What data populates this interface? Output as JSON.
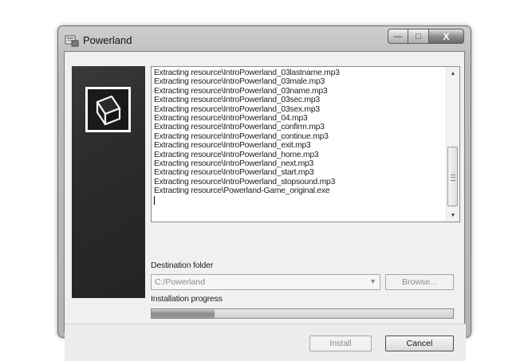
{
  "window": {
    "title": "Powerland",
    "caption": {
      "minimize": "—",
      "maximize": "□",
      "close": "X"
    }
  },
  "log": {
    "lines": [
      "Extracting resource\\IntroPowerland_03lastname.mp3",
      "Extracting resource\\IntroPowerland_03male.mp3",
      "Extracting resource\\IntroPowerland_03name.mp3",
      "Extracting resource\\IntroPowerland_03sec.mp3",
      "Extracting resource\\IntroPowerland_03sex.mp3",
      "Extracting resource\\IntroPowerland_04.mp3",
      "Extracting resource\\IntroPowerland_confirm.mp3",
      "Extracting resource\\IntroPowerland_continue.mp3",
      "Extracting resource\\IntroPowerland_exit.mp3",
      "Extracting resource\\IntroPowerland_home.mp3",
      "Extracting resource\\IntroPowerland_next.mp3",
      "Extracting resource\\IntroPowerland_start.mp3",
      "Extracting resource\\IntroPowerland_stopsound.mp3",
      "Extracting resource\\Powerland-Game_original.exe"
    ]
  },
  "destination": {
    "label": "Destination folder",
    "value": "C:/Powerland",
    "browse_label": "Browse..."
  },
  "progress": {
    "label": "Installation progress",
    "fraction": 0.21
  },
  "buttons": {
    "install_label": "Install",
    "cancel_label": "Cancel"
  },
  "icons": {
    "app": "installer-box-icon",
    "logo": "box-icon"
  }
}
